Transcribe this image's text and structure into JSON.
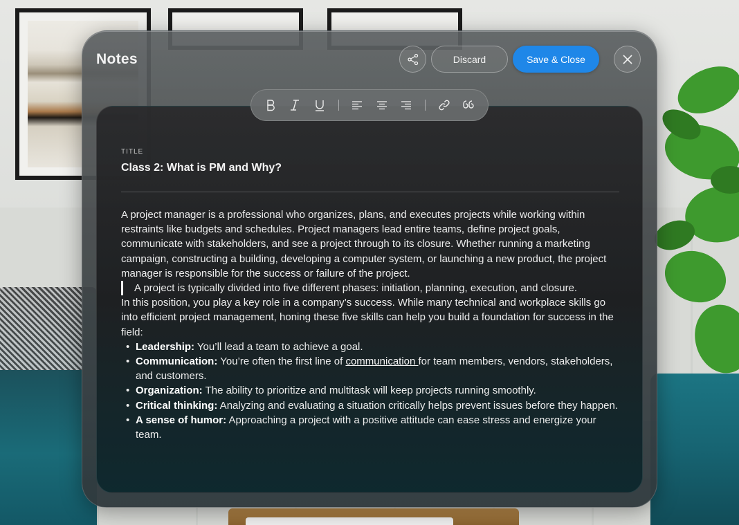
{
  "window": {
    "title": "Notes",
    "share_icon": "share-icon",
    "discard_label": "Discard",
    "save_label": "Save & Close",
    "close_icon": "close-icon",
    "accent_color": "#1f87e8"
  },
  "toolbar": {
    "items": [
      "bold-icon",
      "italic-icon",
      "underline-icon",
      "align-left-icon",
      "align-center-icon",
      "align-right-icon",
      "link-icon",
      "quote-icon"
    ]
  },
  "note": {
    "title_label": "TITLE",
    "title_value": "Class 2: What is PM and Why?",
    "paragraph1": "A project manager is a professional who organizes, plans, and executes projects while working within restraints like budgets and schedules. Project managers lead entire teams, define project goals, communicate with stakeholders, and see a project through to its closure. Whether running a marketing campaign, constructing a building, developing a computer system, or launching a new product, the project manager is responsible for the success or failure of the project.",
    "quote": "A project is typically divided into five different phases: initiation, planning, execution, and closure.",
    "paragraph2": "In this position, you play a key role in a company’s success. While many technical and workplace skills go into efficient project management, honing these five skills can help you build a foundation for success in the field:",
    "skills": [
      {
        "term": "Leadership:",
        "text": " You’ll lead a team to achieve a goal."
      },
      {
        "term": "Communication:",
        "text_before": " You’re often the first line of ",
        "link": "communication ",
        "text_after": "for team members, vendors, stakeholders, and customers."
      },
      {
        "term": "Organization:",
        "text": " The ability to prioritize and multitask will keep projects running smoothly."
      },
      {
        "term": "Critical thinking:",
        "text": " Analyzing and evaluating a situation critically helps prevent issues before they happen."
      },
      {
        "term": "A sense of humor:",
        "text": " Approaching a project with a positive attitude can ease stress and energize your team."
      }
    ]
  }
}
